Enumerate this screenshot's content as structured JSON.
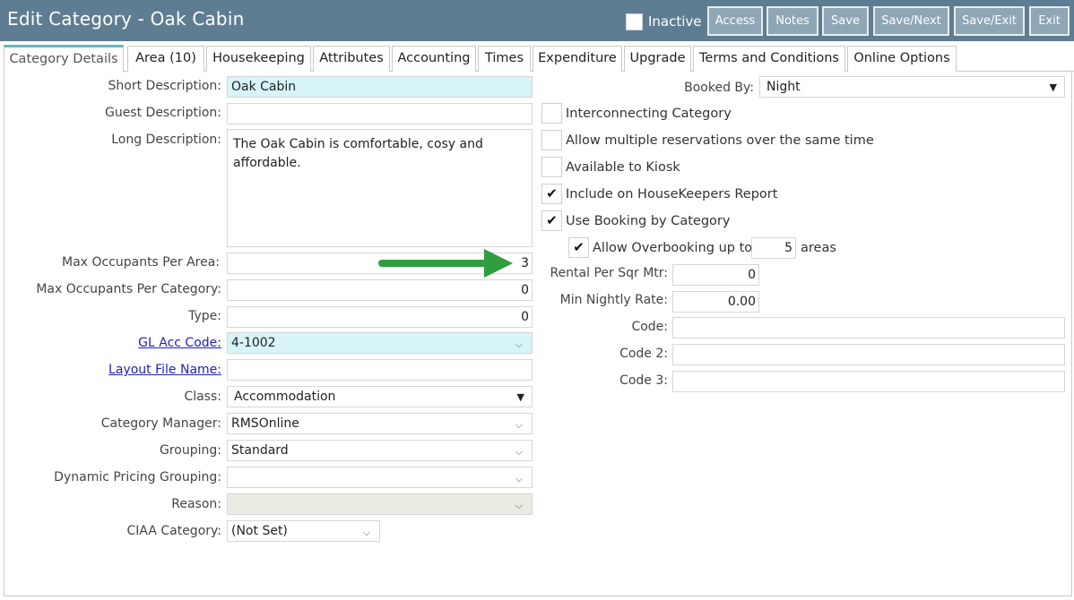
{
  "header": {
    "title": "Edit Category - Oak Cabin",
    "inactive_label": "Inactive",
    "buttons": {
      "access": "Access",
      "notes": "Notes",
      "save": "Save",
      "save_next": "Save/Next",
      "save_exit": "Save/Exit",
      "exit": "Exit"
    }
  },
  "tabs": [
    "Category Details",
    "Area (10)",
    "Housekeeping",
    "Attributes",
    "Accounting",
    "Times",
    "Expenditure",
    "Upgrade",
    "Terms and Conditions",
    "Online Options"
  ],
  "left": {
    "short_description": {
      "label": "Short Description:",
      "value": "Oak Cabin"
    },
    "guest_description": {
      "label": "Guest Description:",
      "value": ""
    },
    "long_description": {
      "label": "Long Description:",
      "value": "The Oak Cabin is comfortable, cosy and affordable."
    },
    "max_occ_area": {
      "label": "Max Occupants Per Area:",
      "value": "3"
    },
    "max_occ_category": {
      "label": "Max Occupants Per Category:",
      "value": "0"
    },
    "type": {
      "label": "Type:",
      "value": "0"
    },
    "gl_acc_code": {
      "label": "GL Acc Code:",
      "value": "4-1002"
    },
    "layout_file": {
      "label": "Layout File Name:",
      "value": ""
    },
    "class": {
      "label": "Class:",
      "value": "Accommodation"
    },
    "category_manager": {
      "label": "Category Manager:",
      "value": "RMSOnline"
    },
    "grouping": {
      "label": "Grouping:",
      "value": "Standard"
    },
    "dynamic_pricing": {
      "label": "Dynamic Pricing Grouping:",
      "value": ""
    },
    "reason": {
      "label": "Reason:",
      "value": ""
    },
    "ciaa": {
      "label": "CIAA Category:",
      "value": "(Not Set)"
    }
  },
  "right": {
    "booked_by": {
      "label": "Booked By:",
      "value": "Night"
    },
    "checkboxes": {
      "interconnecting": {
        "label": "Interconnecting Category",
        "checked": false
      },
      "multiple_res": {
        "label": "Allow multiple reservations over the same time",
        "checked": false
      },
      "kiosk": {
        "label": "Available to Kiosk",
        "checked": false
      },
      "housekeepers": {
        "label": "Include on HouseKeepers Report",
        "checked": true
      },
      "booking_by_category": {
        "label": "Use Booking by Category",
        "checked": true
      },
      "overbooking": {
        "label": "Allow Overbooking up to",
        "checked": true,
        "value": "5",
        "suffix": "areas"
      }
    },
    "rental_sqm": {
      "label": "Rental Per Sqr Mtr:",
      "value": "0"
    },
    "min_nightly": {
      "label": "Min Nightly Rate:",
      "value": "0.00"
    },
    "code": {
      "label": "Code:",
      "value": ""
    },
    "code2": {
      "label": "Code 2:",
      "value": ""
    },
    "code3": {
      "label": "Code 3:",
      "value": ""
    }
  },
  "glyphs": {
    "check": "✔",
    "chevron": "⌵",
    "caret": "▼"
  },
  "colors": {
    "titlebar": "#5f7d92",
    "button": "#8ea6b5",
    "highlight": "#d7f4f8",
    "arrow": "#2e9e3e",
    "link": "#2020c0"
  }
}
